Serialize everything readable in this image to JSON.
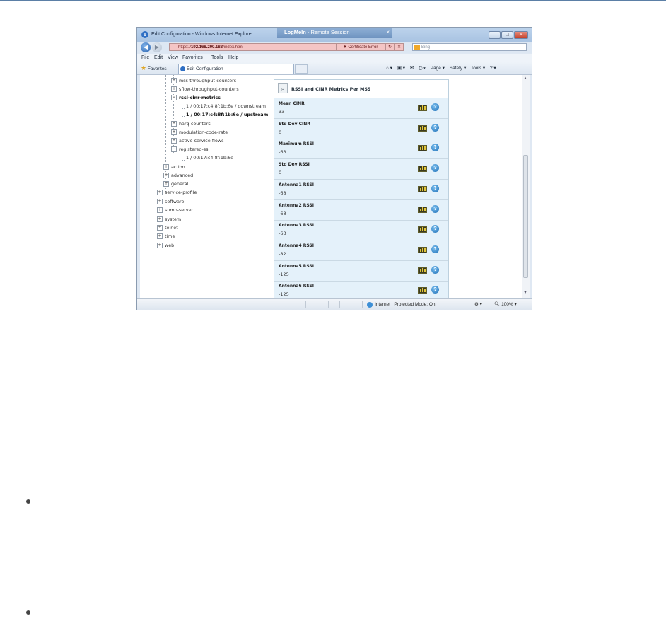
{
  "window": {
    "title": "Edit Configuration - Windows Internet Explorer",
    "session_label": "LogMeIn",
    "session_suffix": " - Remote Session",
    "session_close": "×",
    "minimize": "–",
    "restore": "□",
    "close": "×"
  },
  "address": {
    "url_prefix": "https://",
    "url_host": "192.168.200.183",
    "url_path": "/index.html",
    "cert_error": "Certificate Error",
    "search_placeholder": "Bing"
  },
  "menu": [
    "File",
    "Edit",
    "View",
    "Favorites",
    "Tools",
    "Help"
  ],
  "favorites": {
    "label": "Favorites",
    "tab_title": "Edit Configuration",
    "commands": [
      "Page ▾",
      "Safety ▾",
      "Tools ▾",
      "? ▾"
    ]
  },
  "tree": {
    "items": [
      {
        "label": "mss-throughput-counters"
      },
      {
        "label": "sflow-throughput-counters"
      },
      {
        "label": "rssi-cinr-metrics"
      },
      {
        "label": "1 / 00:17:c4:8f:1b:6e / downstream"
      },
      {
        "label": "1 / 00:17:c4:8f:1b:6e / upstream"
      },
      {
        "label": "harq-counters"
      },
      {
        "label": "modulation-code-rate"
      },
      {
        "label": "active-service-flows"
      },
      {
        "label": "registered-ss"
      },
      {
        "label": "1 / 00:17:c4:8f:1b:6e"
      },
      {
        "label": "action"
      },
      {
        "label": "advanced"
      },
      {
        "label": "general"
      },
      {
        "label": "service-profile"
      },
      {
        "label": "software"
      },
      {
        "label": "snmp-server"
      },
      {
        "label": "system"
      },
      {
        "label": "telnet"
      },
      {
        "label": "time"
      },
      {
        "label": "web"
      }
    ]
  },
  "panel": {
    "title": "RSSI and CINR Metrics Per MSS",
    "metrics": [
      {
        "label": "Mean CINR",
        "value": "33"
      },
      {
        "label": "Std Dev CINR",
        "value": "0"
      },
      {
        "label": "Maximum RSSI",
        "value": "-63"
      },
      {
        "label": "Std Dev RSSI",
        "value": "0"
      },
      {
        "label": "Antenna1 RSSI",
        "value": "-68"
      },
      {
        "label": "Antenna2 RSSI",
        "value": "-68"
      },
      {
        "label": "Antenna3 RSSI",
        "value": "-63"
      },
      {
        "label": "Antenna4 RSSI",
        "value": "-82"
      },
      {
        "label": "Antenna5 RSSI",
        "value": "-125"
      },
      {
        "label": "Antenna6 RSSI",
        "value": "-125"
      }
    ]
  },
  "status": {
    "zone": "Internet | Protected Mode: On",
    "zoom": "100%"
  },
  "colors": {
    "panel_bg": "#e4f1fa",
    "address_error_bg": "#f4c5c5",
    "help_blue": "#1e6fb6"
  }
}
